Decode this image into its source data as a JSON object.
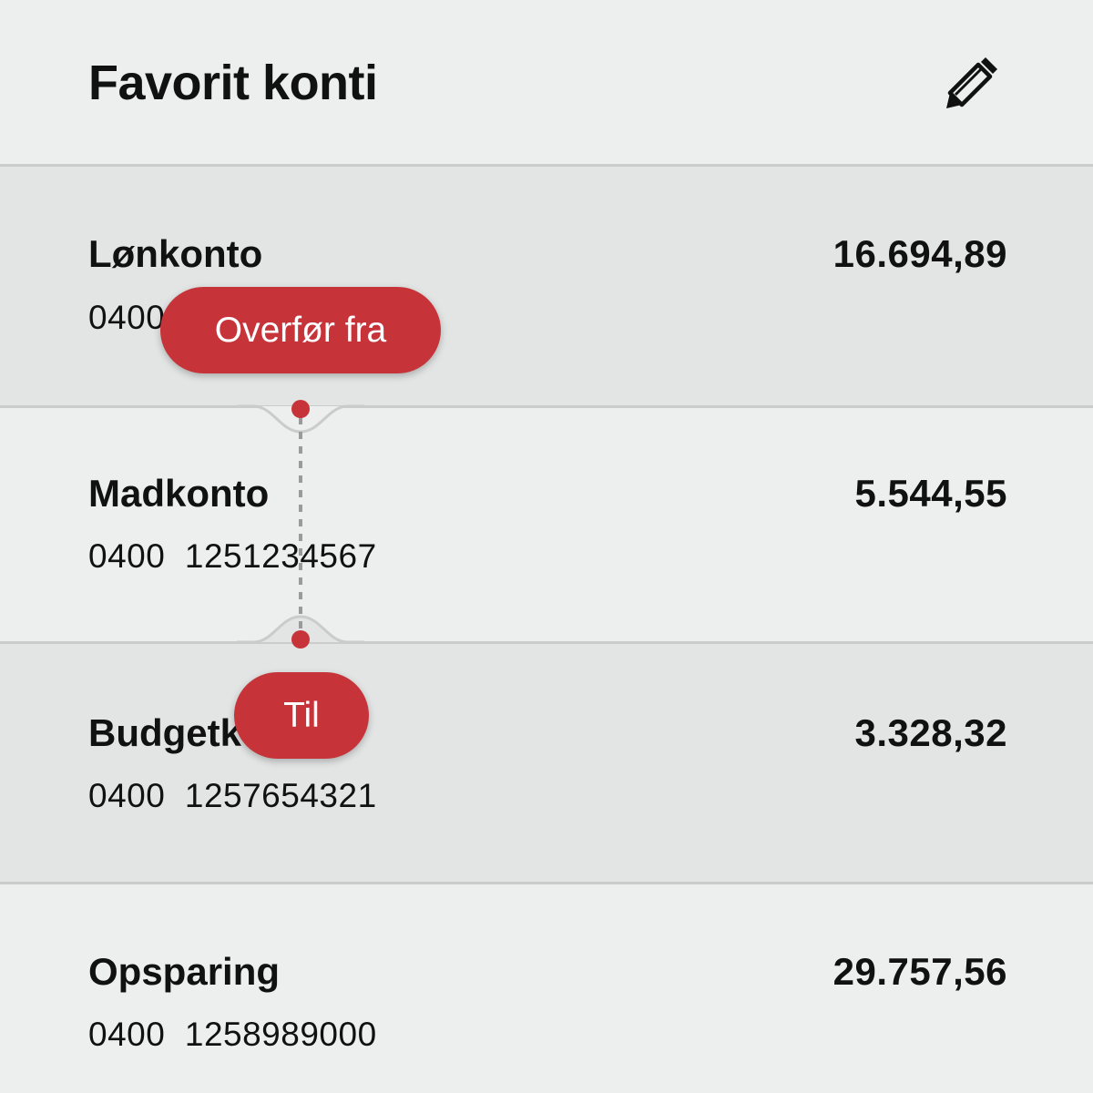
{
  "header": {
    "title": "Favorit konti",
    "edit_icon": "pencil-icon"
  },
  "accounts": [
    {
      "name": "Lønkonto",
      "number": "0400  1251234567",
      "balance": "16.694,89",
      "shaded": true
    },
    {
      "name": "Madkonto",
      "number": "0400  1251234567",
      "balance": "5.544,55",
      "shaded": false
    },
    {
      "name": "Budgetkonto",
      "number": "0400  1257654321",
      "balance": "3.328,32",
      "shaded": true
    },
    {
      "name": "Opsparing",
      "number": "0400  1258989000",
      "balance": "29.757,56",
      "shaded": false
    }
  ],
  "transfer": {
    "from_label": "Overfør fra",
    "to_label": "Til"
  },
  "colors": {
    "accent": "#c6343a",
    "background": "#ecefee",
    "row_shaded": "#e2e5e4",
    "divider": "#c9cccb"
  }
}
